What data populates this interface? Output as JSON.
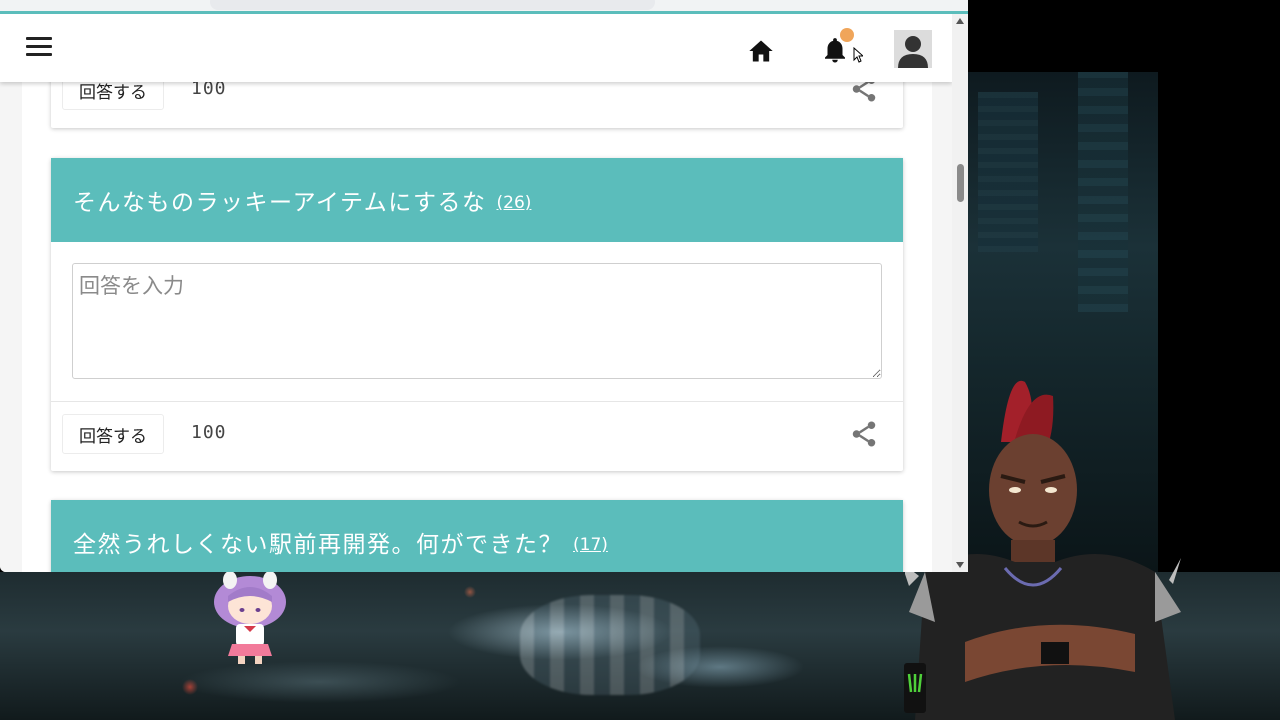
{
  "cards": [
    {
      "answer_button": "回答する",
      "points": "100"
    },
    {
      "title": "そんなものラッキーアイテムにするな",
      "count": "(26)",
      "answer_placeholder": "回答を入力",
      "answer_button": "回答する",
      "points": "100"
    },
    {
      "title": "全然うれしくない駅前再開発。何ができた？",
      "count": "(17)"
    }
  ],
  "appbar": {
    "menu_icon": "hamburger-menu-icon",
    "home_icon": "home-icon",
    "notification_icon": "bell-icon",
    "notification_badge_color": "#f0a55a",
    "avatar_icon": "user-avatar-icon"
  },
  "colors": {
    "accent": "#5bbdbb",
    "card_header_text": "#ffffff"
  }
}
